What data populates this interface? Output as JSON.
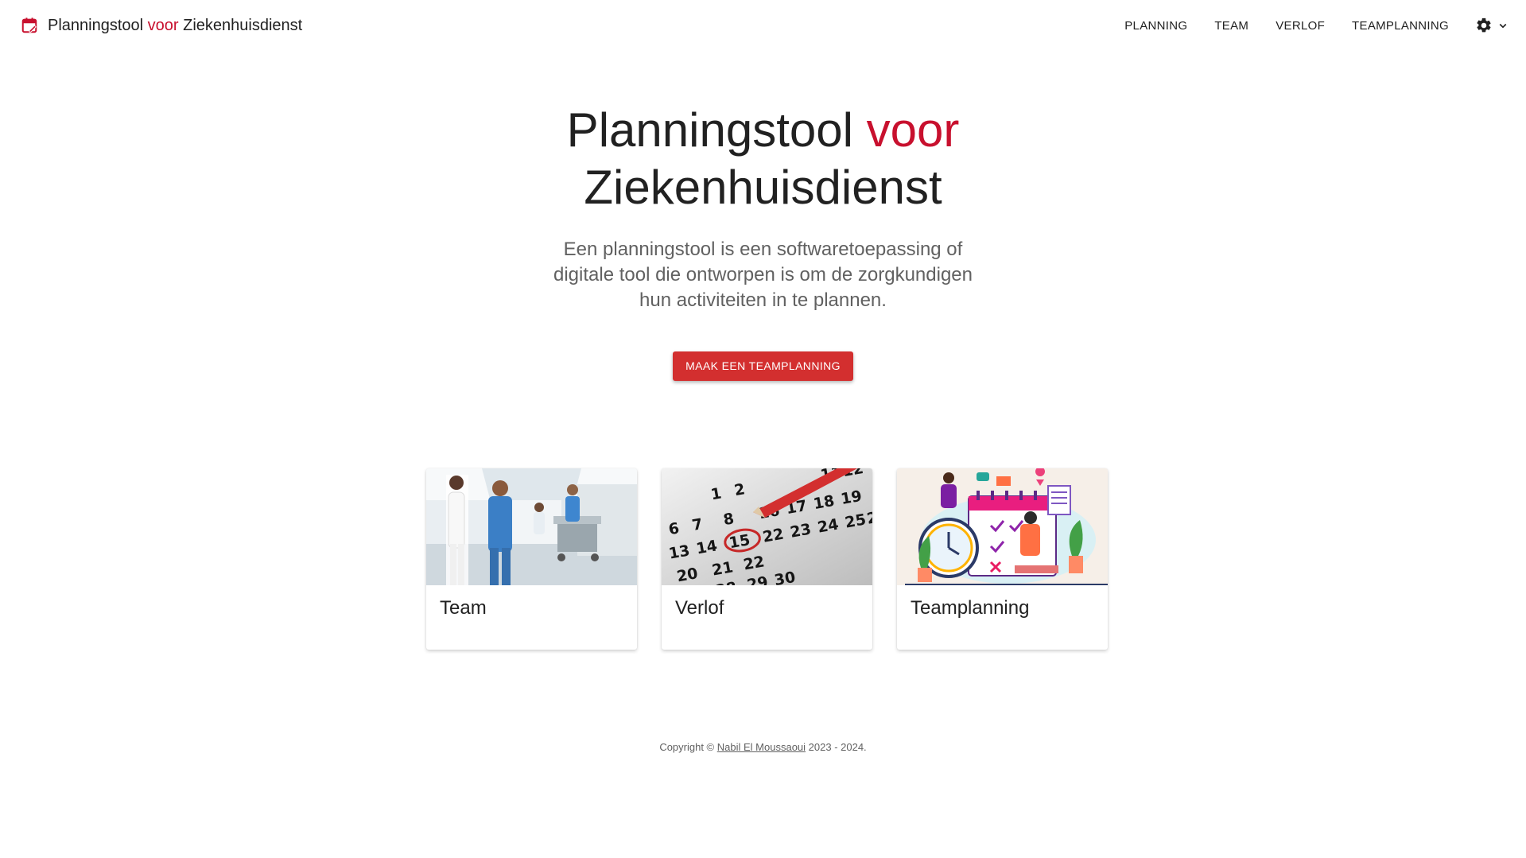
{
  "app": {
    "brand": {
      "part1": "Planningstool ",
      "part2": "voor",
      "part3": " Ziekenhuisdienst"
    }
  },
  "nav": {
    "items": [
      {
        "label": "PLANNING"
      },
      {
        "label": "TEAM"
      },
      {
        "label": "VERLOF"
      },
      {
        "label": "TEAMPLANNING"
      }
    ],
    "settings_icon": "gear-icon",
    "dropdown_icon": "chevron-down-icon"
  },
  "hero": {
    "title_part1": "Planningstool ",
    "title_part2": "voor",
    "title_part3": "Ziekenhuisdienst",
    "subtitle": "Een planningstool is een softwaretoepassing of digitale tool die ontworpen is om de zorgkundigen hun activiteiten in te plannen.",
    "cta_label": "MAAK EEN TEAMPLANNING"
  },
  "cards": [
    {
      "title": "Team"
    },
    {
      "title": "Verlof"
    },
    {
      "title": "Teamplanning"
    }
  ],
  "footer": {
    "prefix": "Copyright © ",
    "author": "Nabil El Moussaoui",
    "suffix": " 2023 - 2024."
  },
  "colors": {
    "accent": "#c8102e",
    "button": "#d32f2f",
    "text": "#212121",
    "muted": "#616161"
  }
}
